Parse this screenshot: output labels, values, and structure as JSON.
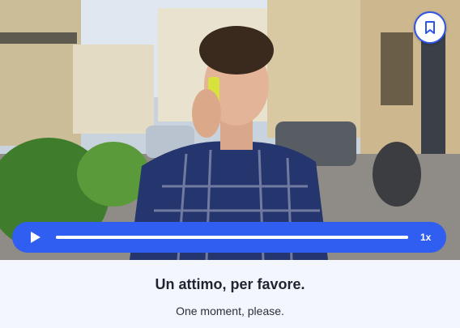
{
  "video": {
    "description_icon": "video-frame",
    "bookmark_icon": "bookmark-icon"
  },
  "player": {
    "play_icon": "play-icon",
    "progress": 1.0,
    "speed_label": "1x"
  },
  "caption": {
    "phrase": "Un attimo, per favore.",
    "translation": "One moment, please."
  },
  "colors": {
    "accent": "#2f5ef0",
    "background": "#f3f6fc"
  }
}
